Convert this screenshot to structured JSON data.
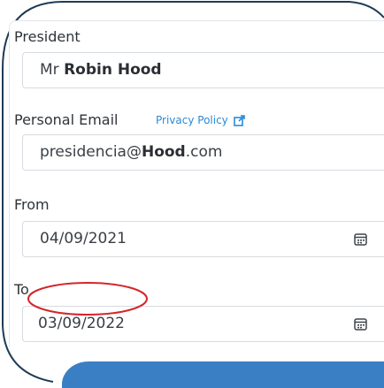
{
  "form": {
    "president": {
      "label": "President",
      "value_prefix": "Mr",
      "value_name": "Robin Hood"
    },
    "email": {
      "label": "Personal Email",
      "privacy_link": "Privacy Policy",
      "value_prefix": "presidencia@",
      "value_bold": "Hood",
      "value_suffix": ".com"
    },
    "from": {
      "label": "From",
      "value": "04/09/2021"
    },
    "to": {
      "label": "To",
      "value": "03/09/2022"
    }
  },
  "icons": {
    "calendar": "calendar-icon",
    "external": "external-link-icon"
  },
  "colors": {
    "link": "#2b8ad6",
    "highlight_oval": "#d3262c",
    "button": "#3a7fc4",
    "frame": "#1f3b57"
  }
}
